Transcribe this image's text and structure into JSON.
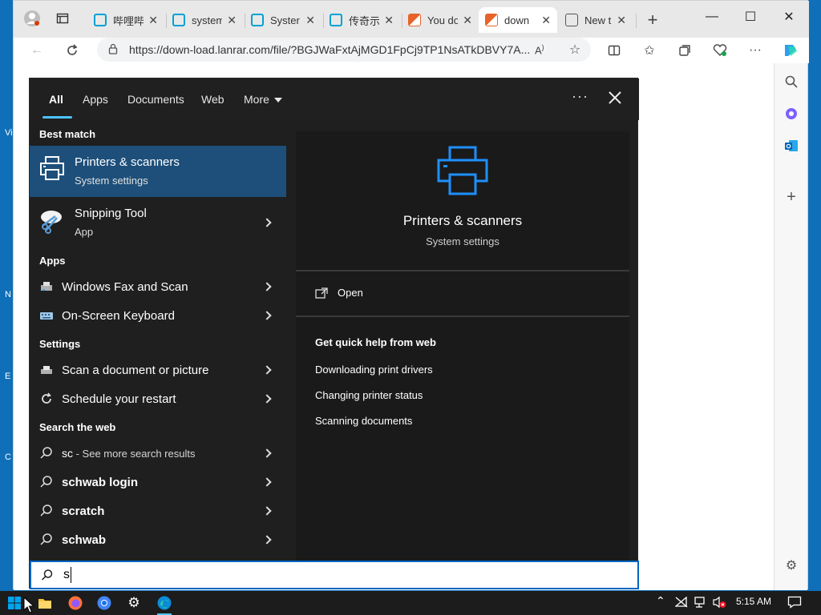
{
  "browser": {
    "tabs": [
      {
        "label": "哔哩哔",
        "color": "#00a1d6"
      },
      {
        "label": "system",
        "color": "#00a1d6"
      },
      {
        "label": "Syster",
        "color": "#00a1d6"
      },
      {
        "label": "传奇示",
        "color": "#00a1d6"
      },
      {
        "label": "You do",
        "color": "#e8632a"
      },
      {
        "label": "down",
        "color": "#e8632a",
        "active": true
      },
      {
        "label": "New t",
        "color": "#666666"
      }
    ],
    "url": "https://down-load.lanrar.com/file/?BGJWaFxtAjMGD1FpCj9TP1NsATkDBVY7A..."
  },
  "search": {
    "tabs": {
      "all": "All",
      "apps": "Apps",
      "documents": "Documents",
      "web": "Web",
      "more": "More"
    },
    "sections": {
      "best_match": "Best match",
      "apps": "Apps",
      "settings": "Settings",
      "web": "Search the web"
    },
    "best_match": [
      {
        "title": "Printers & scanners",
        "subtitle": "System settings"
      },
      {
        "title": "Snipping Tool",
        "subtitle": "App"
      }
    ],
    "apps": [
      "Windows Fax and Scan",
      "On-Screen Keyboard"
    ],
    "settings": [
      "Scan a document or picture",
      "Schedule your restart"
    ],
    "web": {
      "first_query": "sc",
      "first_suffix": " - See more search results",
      "items": [
        "schwab login",
        "scratch",
        "schwab"
      ]
    },
    "preview": {
      "title": "Printers & scanners",
      "subtitle": "System settings",
      "open": "Open",
      "help_heading": "Get quick help from web",
      "help_links": [
        "Downloading print drivers",
        "Changing printer status",
        "Scanning documents"
      ]
    },
    "query": "s"
  },
  "taskbar": {
    "time": "5:15 AM"
  },
  "colors": {
    "accent": "#0078d4",
    "selected": "#1d4f7a"
  }
}
